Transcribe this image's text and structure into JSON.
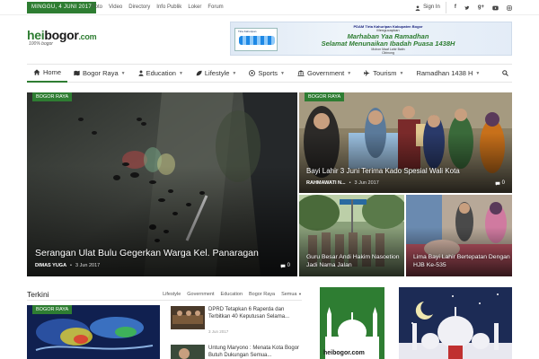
{
  "topbar": {
    "date": "MINGGU, 4 JUNI 2017",
    "links": [
      "Foto",
      "Video",
      "Directory",
      "Info Publik",
      "Loker",
      "Forum"
    ],
    "signin": "Sign In",
    "social_icons": [
      "facebook-icon",
      "twitter-icon",
      "google-plus-icon",
      "youtube-icon",
      "instagram-icon"
    ]
  },
  "logo": {
    "part1": "hei",
    "part2": "bogor",
    "suffix": ".com",
    "tagline": "100% bogor"
  },
  "banner": {
    "line1": "PDAM Tirta Kahuripan Kabupaten Bogor",
    "line2": "Mengucapkan",
    "line3": "Marhaban Yaa Ramadhan",
    "line4": "Selamat Menunaikan Ibadah Puasa 1438H",
    "line5": "Mohon Maaf Lahir Batin",
    "line6": "Cibinong",
    "logo_text": "Tirta Kahuripan"
  },
  "nav": {
    "items": [
      {
        "label": "Home",
        "icon": "home-icon",
        "caret": false,
        "active": true
      },
      {
        "label": "Bogor Raya",
        "icon": "map-icon",
        "caret": true
      },
      {
        "label": "Education",
        "icon": "user-icon",
        "caret": true
      },
      {
        "label": "Lifestyle",
        "icon": "leaf-icon",
        "caret": true
      },
      {
        "label": "Sports",
        "icon": "ball-icon",
        "caret": true
      },
      {
        "label": "Government",
        "icon": "building-icon",
        "caret": true
      },
      {
        "label": "Tourism",
        "icon": "plane-icon",
        "caret": true
      },
      {
        "label": "Ramadhan 1438 H",
        "icon": "",
        "caret": true
      }
    ]
  },
  "hero": {
    "main": {
      "tag": "BOGOR RAYA",
      "title": "Serangan Ulat Bulu Gegerkan Warga Kel. Panaragan",
      "author": "DIMAS YUGA",
      "date": "3 Jun 2017",
      "comments": "0"
    },
    "top_right": {
      "tag": "BOGOR RAYA",
      "title": "Bayi Lahir 3 Juni Terima Kado Spesial Wali Kota",
      "author": "RAHMAWATI N...",
      "date": "3 Jun 2017",
      "comments": "0"
    },
    "bottom_left": {
      "title": "Guru Besar Andi Hakim Nasoetion Jadi Nama Jalan"
    },
    "bottom_right": {
      "title": "Lima Bayi Lahir Bertepatan Dengan HJB Ke-535"
    }
  },
  "terkini": {
    "title": "Terkini",
    "filters": [
      "Lifestyle",
      "Government",
      "Education",
      "Bogor Raya",
      "Semua"
    ],
    "feature_tag": "BOGOR RAYA",
    "items": [
      {
        "title": "DPRD Tetapkan 6 Raperda dan Terbitkan 40 Keputusan Selama...",
        "date": "3 Jun 2017"
      },
      {
        "title": "Untung Maryono : Menata Kota Bogor Butuh Dukungan Semua...",
        "date": ""
      }
    ]
  },
  "ads": {
    "ad1_text": "heibogor.com"
  }
}
